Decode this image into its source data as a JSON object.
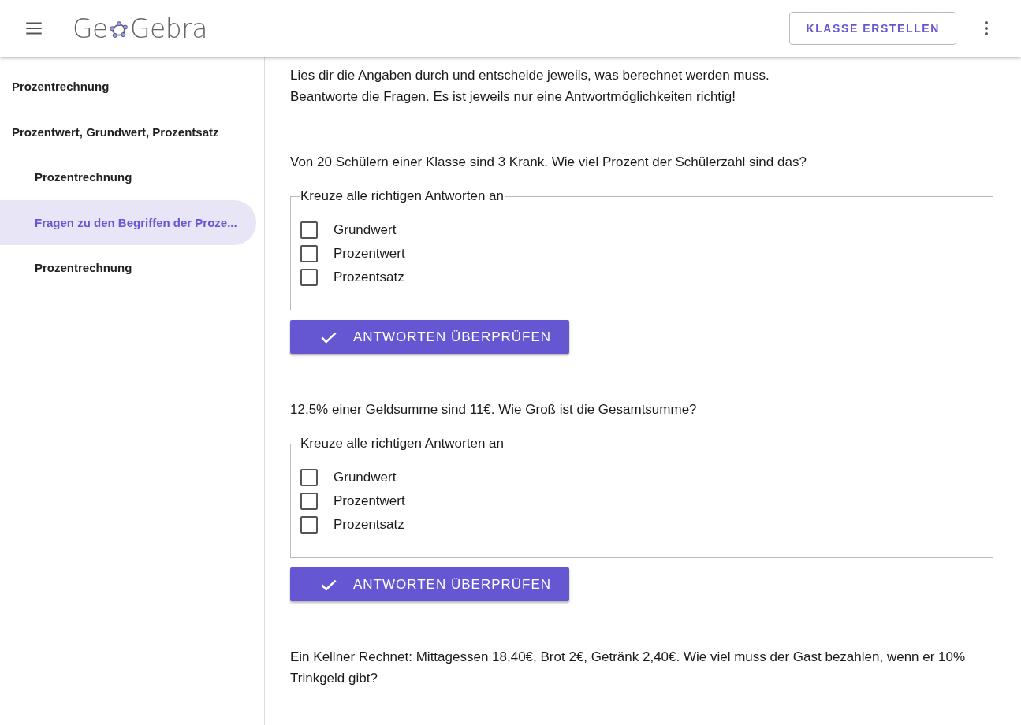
{
  "header": {
    "logo_before": "Ge",
    "logo_after": "Gebra",
    "button": "KLASSE ERSTELLEN"
  },
  "sidebar": {
    "items": [
      {
        "label": "Prozentrechnung",
        "selected": false
      },
      {
        "label": "Prozentwert, Grundwert, Prozentsatz",
        "selected": false,
        "children": [
          {
            "label": "Prozentrechnung",
            "selected": false
          },
          {
            "label": "Fragen zu den Begriffen der Proze...",
            "selected": true
          },
          {
            "label": "Prozentrechnung",
            "selected": false
          }
        ]
      }
    ]
  },
  "intro": [
    "Lies dir die Angaben durch und entscheide jeweils, was berechnet werden muss.",
    "Beantworte die Fragen. Es ist jeweils nur eine Antwortmöglichkeiten richtig!"
  ],
  "questions": [
    {
      "text": "Von 20 Schülern einer Klasse sind 3 Krank. Wie viel Prozent der Schülerzahl sind das?",
      "legend": "Kreuze alle richtigen Antworten an",
      "options": [
        {
          "label": "Grundwert",
          "checked": false
        },
        {
          "label": "Prozentwert",
          "checked": false
        },
        {
          "label": "Prozentsatz",
          "checked": false
        }
      ],
      "button": "ANTWORTEN ÜBERPRÜFEN"
    },
    {
      "text": "12,5% einer Geldsumme sind 11€. Wie Groß ist die Gesamtsumme?",
      "legend": "Kreuze alle richtigen Antworten an",
      "options": [
        {
          "label": "Grundwert",
          "checked": false
        },
        {
          "label": "Prozentwert",
          "checked": false
        },
        {
          "label": "Prozentsatz",
          "checked": false
        }
      ],
      "button": "ANTWORTEN ÜBERPRÜFEN"
    },
    {
      "text": "Ein Kellner Rechnet: Mittagessen 18,40€, Brot 2€, Getränk 2,40€. Wie viel muss der Gast bezahlen, wenn er 10% Trinkgeld gibt?"
    }
  ]
}
